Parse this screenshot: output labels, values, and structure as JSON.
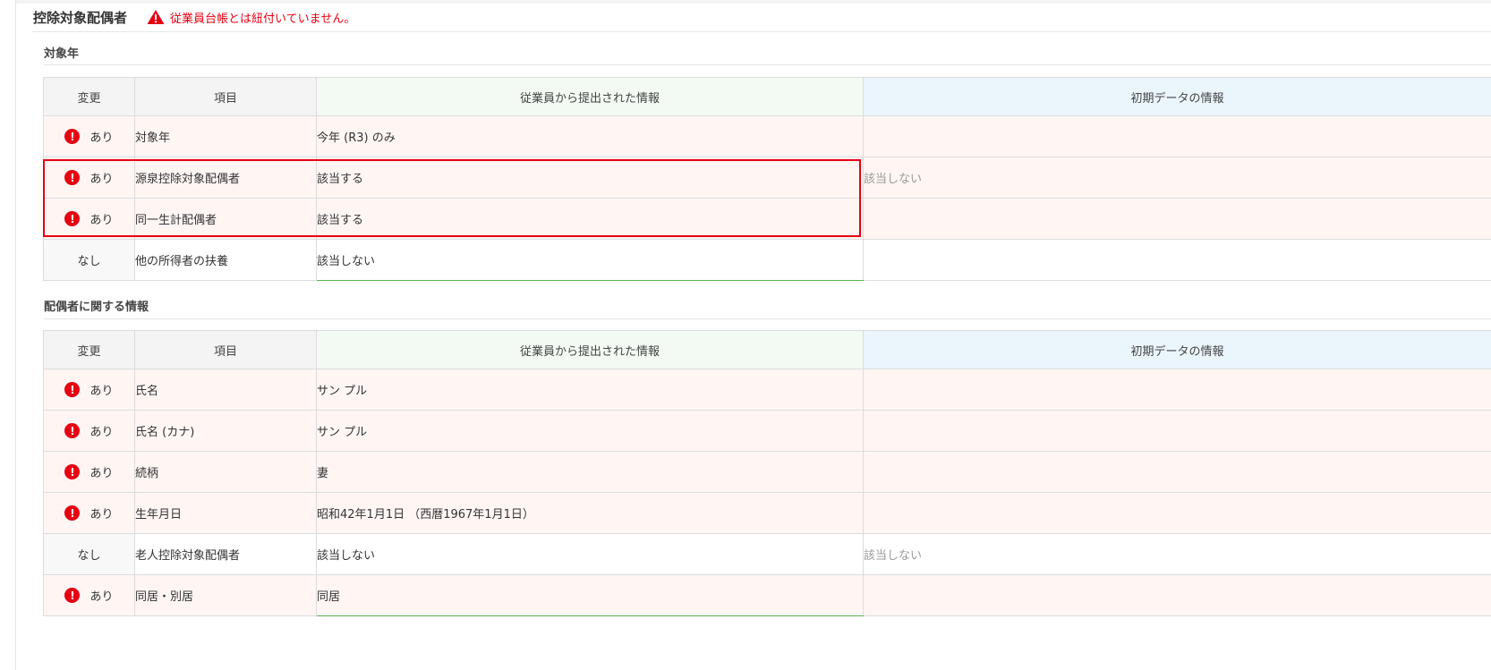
{
  "section": {
    "title": "控除対象配偶者",
    "warning": "従業員台帳とは紐付いていません。"
  },
  "colors": {
    "alert": "#e60012",
    "employee_border": "#58b24f",
    "initial_header": "#eaf5fc"
  },
  "icons": {
    "warning": "warning-triangle-icon",
    "error": "exclamation-circle-icon"
  },
  "target_year": {
    "title": "対象年",
    "headers": {
      "change": "変更",
      "item": "項目",
      "employee": "従業員から提出された情報",
      "initial": "初期データの情報"
    },
    "rows": [
      {
        "change": "あり",
        "changed": true,
        "item": "対象年",
        "employee": "今年 (R3) のみ",
        "initial": ""
      },
      {
        "change": "あり",
        "changed": true,
        "item": "源泉控除対象配偶者",
        "employee": "該当する",
        "initial": "該当しない"
      },
      {
        "change": "あり",
        "changed": true,
        "item": "同一生計配偶者",
        "employee": "該当する",
        "initial": ""
      },
      {
        "change": "なし",
        "changed": false,
        "item": "他の所得者の扶養",
        "employee": "該当しない",
        "initial": ""
      }
    ]
  },
  "spouse_info": {
    "title": "配偶者に関する情報",
    "headers": {
      "change": "変更",
      "item": "項目",
      "employee": "従業員から提出された情報",
      "initial": "初期データの情報"
    },
    "rows": [
      {
        "change": "あり",
        "changed": true,
        "item": "氏名",
        "employee": "サン プル",
        "initial": ""
      },
      {
        "change": "あり",
        "changed": true,
        "item": "氏名 (カナ)",
        "employee": "サン プル",
        "initial": ""
      },
      {
        "change": "あり",
        "changed": true,
        "item": "続柄",
        "employee": "妻",
        "initial": ""
      },
      {
        "change": "あり",
        "changed": true,
        "item": "生年月日",
        "employee": "昭和42年1月1日 （西暦1967年1月1日）",
        "initial": ""
      },
      {
        "change": "なし",
        "changed": false,
        "item": "老人控除対象配偶者",
        "employee": "該当しない",
        "initial": "該当しない"
      },
      {
        "change": "あり",
        "changed": true,
        "item": "同居・別居",
        "employee": "同居",
        "initial": ""
      }
    ]
  }
}
